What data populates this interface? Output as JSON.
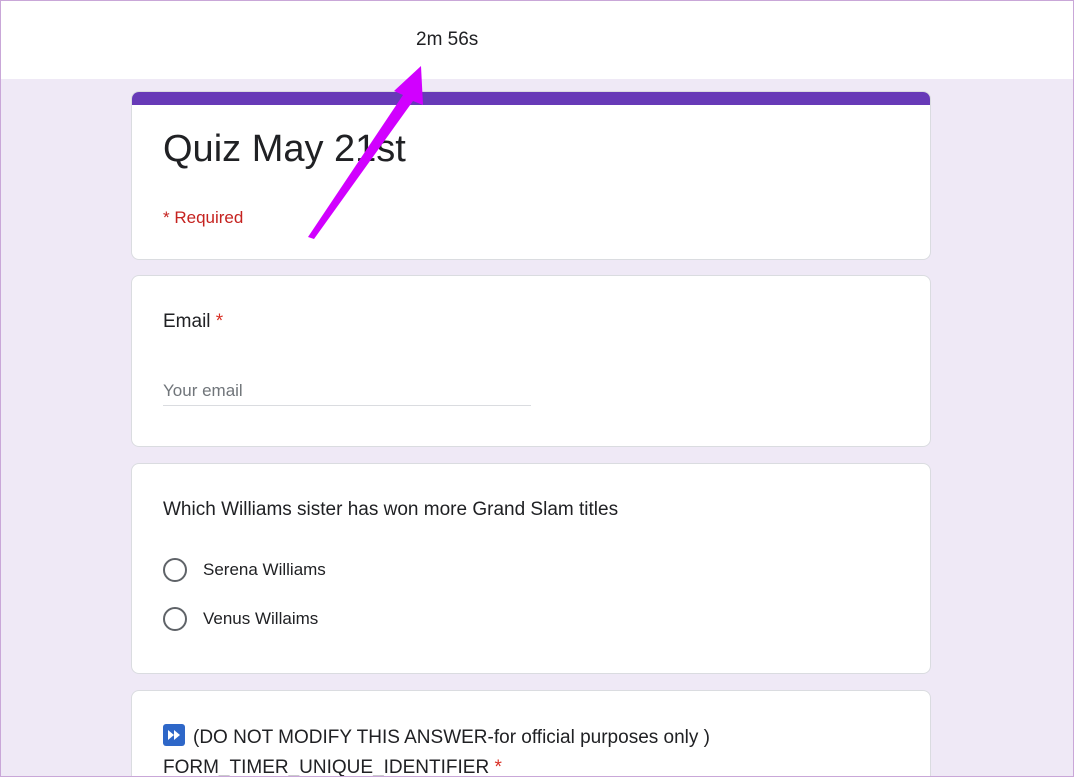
{
  "timer": {
    "remaining": "2m 56s"
  },
  "form": {
    "title": "Quiz May 21st",
    "required_note": "* Required"
  },
  "email_question": {
    "label": "Email",
    "required_mark": "*",
    "placeholder": "Your email"
  },
  "tennis_question": {
    "label": "Which Williams sister has won more Grand Slam titles",
    "options": [
      "Serena Williams",
      "Venus Willaims"
    ]
  },
  "timer_question": {
    "line1": "(DO NOT MODIFY THIS ANSWER-for official purposes only )",
    "line2": "FORM_TIMER_UNIQUE_IDENTIFIER",
    "required_mark": "*",
    "icon": "fast-forward-icon"
  },
  "colors": {
    "accent": "#673ab7",
    "required": "#d93025",
    "annotation_arrow": "#d100ff",
    "background": "#efe9f6"
  }
}
